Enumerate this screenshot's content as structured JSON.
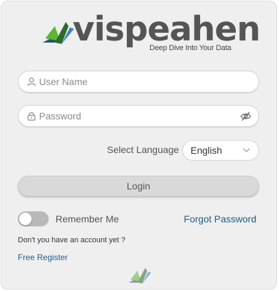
{
  "brand": {
    "name": "vispeahen",
    "tagline": "Deep Dive Into Your Data",
    "colors": {
      "green": "#5cb82e",
      "dark_green": "#2e6b2a",
      "navy": "#2a4a7c",
      "blue": "#3f7fc0"
    }
  },
  "form": {
    "username": {
      "placeholder": "User Name",
      "value": "",
      "icon": "user-icon"
    },
    "password": {
      "placeholder": "Password",
      "value": "",
      "icon": "lock-icon",
      "toggle_icon": "eye-off-icon"
    },
    "language": {
      "label": "Select Language",
      "selected": "English",
      "icon": "chevron-down-icon"
    },
    "login_label": "Login",
    "remember_label": "Remember Me",
    "remember_checked": false,
    "forgot_label": "Forgot Password",
    "no_account_text": "Don't you have an account yet ?",
    "register_label": "Free Register"
  },
  "colors": {
    "link": "#1f5c8c",
    "button_bg": "#d9d9d9",
    "card_bg": "#efefef"
  }
}
